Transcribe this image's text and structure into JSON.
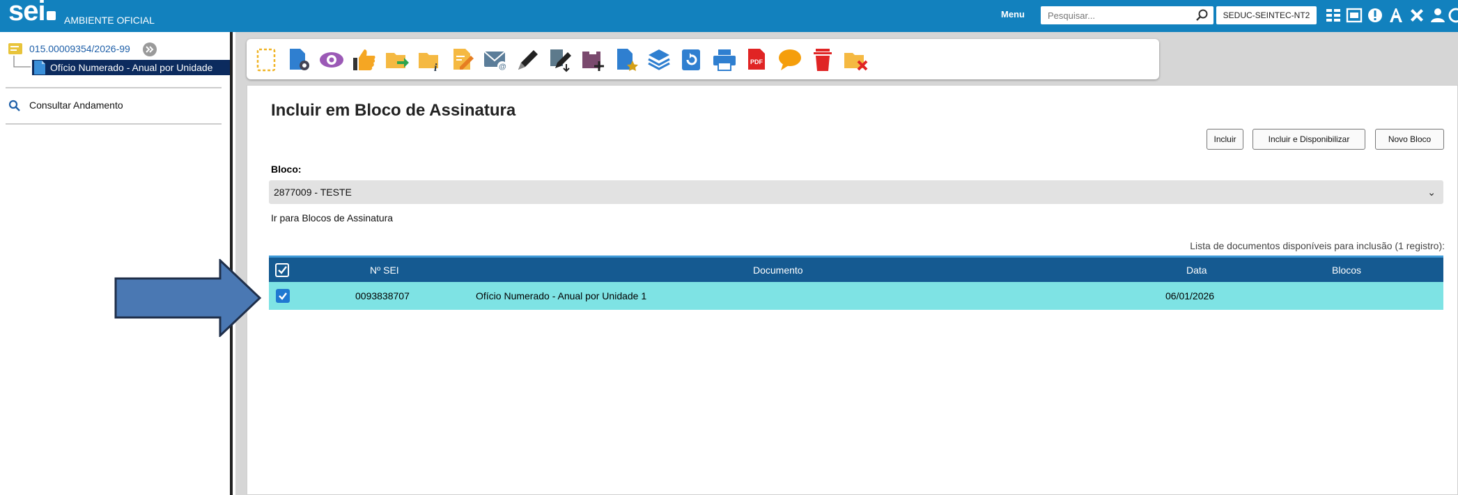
{
  "topbar": {
    "logo": "sei",
    "environment": "AMBIENTE OFICIAL",
    "menu_label": "Menu",
    "search_placeholder": "Pesquisar...",
    "unit": "SEDUC-SEINTEC-NT2",
    "icons": [
      "grid-icon",
      "calendar-icon",
      "alert-icon",
      "font-icon",
      "tools-icon",
      "user-icon",
      "more-icon"
    ]
  },
  "tree": {
    "process_number": "015.00009354/2026-99",
    "document": "Ofício Numerado - Anual por Unidade",
    "consult_label": "Consultar Andamento"
  },
  "toolbar_icons": [
    "new-document-icon",
    "process-settings-icon",
    "view-icon",
    "like-icon",
    "send-process-icon",
    "process-info-icon",
    "edit-document-icon",
    "send-email-icon",
    "sign-icon",
    "sign-multiple-icon",
    "add-to-block-icon",
    "bookmark-icon",
    "layers-icon",
    "refresh-icon",
    "print-icon",
    "pdf-icon",
    "comment-icon",
    "delete-icon",
    "close-process-icon"
  ],
  "page": {
    "title": "Incluir em Bloco de Assinatura",
    "buttons": {
      "incluir": "Incluir",
      "incluir_disponibilizar": "Incluir e Disponibilizar",
      "novo_bloco": "Novo Bloco"
    },
    "bloco_label": "Bloco:",
    "bloco_selected": "2877009 - TESTE",
    "link_blocos": "Ir para Blocos de Assinatura",
    "caption": "Lista de documentos disponíveis para inclusão (1 registro):"
  },
  "table": {
    "headers": [
      "Nº SEI",
      "Documento",
      "Data",
      "Blocos"
    ],
    "rows": [
      {
        "checked": true,
        "numero": "0093838707",
        "documento": "Ofício Numerado - Anual por Unidade 1",
        "data": "06/01/2026",
        "blocos": ""
      }
    ]
  },
  "colors": {
    "topbar": "#1281be",
    "header_row": "#155a91",
    "selected_row": "#7ee3e4",
    "arrow": "#4a78b3"
  }
}
